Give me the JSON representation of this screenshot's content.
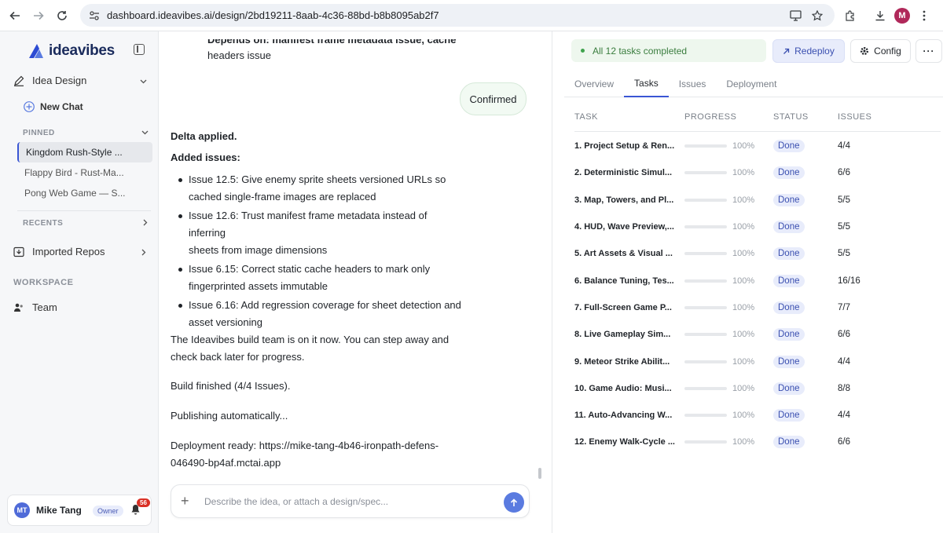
{
  "browser": {
    "url": "dashboard.ideavibes.ai/design/2bd19211-8aab-4c36-88bd-b8b8095ab2f7",
    "profile_initial": "M"
  },
  "sidebar": {
    "brand": "ideavibes",
    "idea_design": "Idea Design",
    "new_chat": "New Chat",
    "pinned_label": "PINNED",
    "pinned": [
      "Kingdom Rush-Style ...",
      "Flappy Bird - Rust-Ma...",
      "Pong Web Game — S..."
    ],
    "recents_label": "RECENTS",
    "imported_repos": "Imported Repos",
    "workspace_label": "WORKSPACE",
    "team": "Team",
    "user": {
      "initials": "MT",
      "name": "Mike Tang",
      "role": "Owner",
      "notifications": "56"
    }
  },
  "chat": {
    "partial_text_1": "Depends on: manifest frame metadata issue, cache",
    "partial_text_2": "headers issue",
    "confirmed": "Confirmed",
    "delta_applied": "Delta applied.",
    "added_issues": "Added issues:",
    "issues": [
      [
        "Issue 12.5: Give enemy sprite sheets versioned URLs so",
        "cached single-frame images are replaced"
      ],
      [
        "Issue 12.6: Trust manifest frame metadata instead of inferring",
        "sheets from image dimensions"
      ],
      [
        "Issue 6.15: Correct static cache headers to mark only",
        "fingerprinted assets immutable"
      ],
      [
        "Issue 6.16: Add regression coverage for sheet detection and",
        "asset versioning"
      ]
    ],
    "build_team_1": "The Ideavibes build team is on it now. You can step away and",
    "build_team_2": "check back later for progress.",
    "build_finished": "Build finished (4/4 Issues).",
    "publishing": "Publishing automatically...",
    "deploy_1": "Deployment ready: https://mike-tang-4b46-ironpath-defens-",
    "deploy_2": "046490-bp4af.mctai.app",
    "composer_placeholder": "Describe the idea, or attach a design/spec..."
  },
  "panel": {
    "status": "All 12 tasks completed",
    "redeploy": "Redeploy",
    "config": "Config",
    "more": "···",
    "tabs": [
      "Overview",
      "Tasks",
      "Issues",
      "Deployment"
    ],
    "active_tab": "Tasks",
    "columns": [
      "TASK",
      "PROGRESS",
      "STATUS",
      "ISSUES"
    ],
    "tasks": [
      {
        "name": "1. Project Setup & Ren...",
        "progress": 100,
        "progress_label": "100%",
        "status": "Done",
        "issues": "4/4"
      },
      {
        "name": "2. Deterministic Simul...",
        "progress": 100,
        "progress_label": "100%",
        "status": "Done",
        "issues": "6/6"
      },
      {
        "name": "3. Map, Towers, and Pl...",
        "progress": 100,
        "progress_label": "100%",
        "status": "Done",
        "issues": "5/5"
      },
      {
        "name": "4. HUD, Wave Preview,...",
        "progress": 100,
        "progress_label": "100%",
        "status": "Done",
        "issues": "5/5"
      },
      {
        "name": "5. Art Assets & Visual ...",
        "progress": 100,
        "progress_label": "100%",
        "status": "Done",
        "issues": "5/5"
      },
      {
        "name": "6. Balance Tuning, Tes...",
        "progress": 100,
        "progress_label": "100%",
        "status": "Done",
        "issues": "16/16"
      },
      {
        "name": "7. Full-Screen Game P...",
        "progress": 100,
        "progress_label": "100%",
        "status": "Done",
        "issues": "7/7"
      },
      {
        "name": "8. Live Gameplay Sim...",
        "progress": 100,
        "progress_label": "100%",
        "status": "Done",
        "issues": "6/6"
      },
      {
        "name": "9. Meteor Strike Abilit...",
        "progress": 100,
        "progress_label": "100%",
        "status": "Done",
        "issues": "4/4"
      },
      {
        "name": "10. Game Audio: Musi...",
        "progress": 100,
        "progress_label": "100%",
        "status": "Done",
        "issues": "8/8"
      },
      {
        "name": "11. Auto-Advancing W...",
        "progress": 100,
        "progress_label": "100%",
        "status": "Done",
        "issues": "4/4"
      },
      {
        "name": "12. Enemy Walk-Cycle ...",
        "progress": 100,
        "progress_label": "100%",
        "status": "Done",
        "issues": "6/6"
      }
    ]
  },
  "colors": {
    "accent": "#3a56d4",
    "progress": "#4f6bd8",
    "success": "#3fa34d"
  }
}
